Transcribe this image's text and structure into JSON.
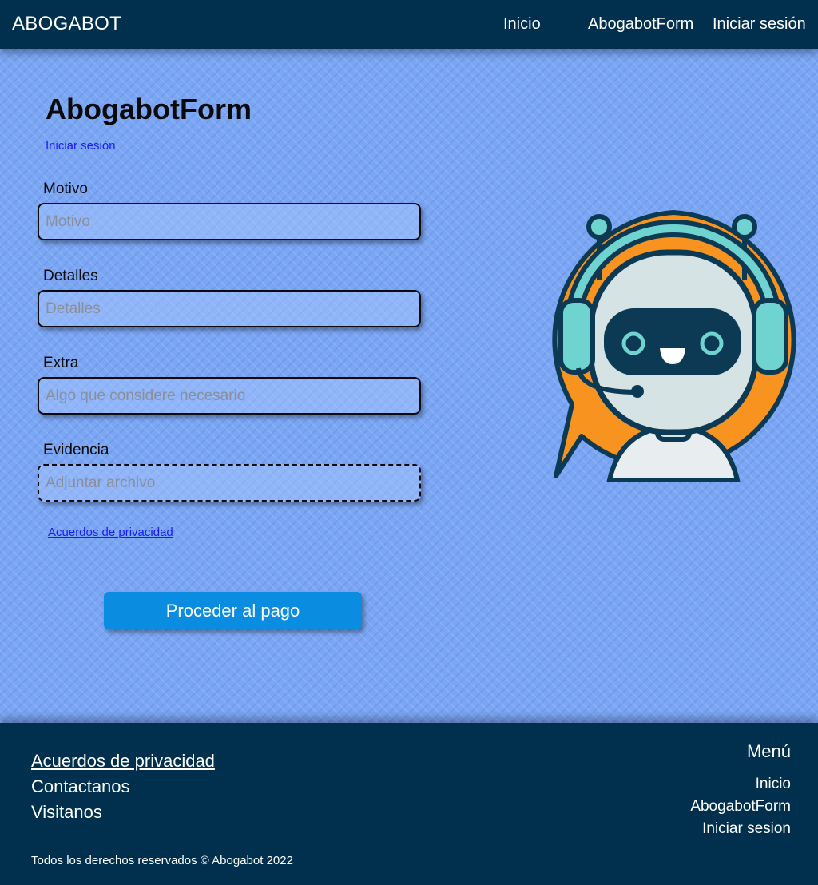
{
  "navbar": {
    "brand": "ABOGABOT",
    "links": [
      "Inicio",
      "AbogabotForm",
      "Iniciar sesión"
    ]
  },
  "form": {
    "title": "AbogabotForm",
    "login_link": "Iniciar sesión",
    "fields": [
      {
        "label": "Motivo",
        "placeholder": "Motivo"
      },
      {
        "label": "Detalles",
        "placeholder": "Detalles"
      },
      {
        "label": "Extra",
        "placeholder": "Algo que considere necesario"
      },
      {
        "label": "Evidencia",
        "placeholder": "Adjuntar archivo"
      }
    ],
    "privacy_link": "Acuerdos de privacidad",
    "submit_label": "Proceder al pago"
  },
  "illustration": {
    "icon": "chatbot-robot-icon",
    "colors": {
      "bubble": "#f7931e",
      "outline": "#0c3a55",
      "headphones": "#6fd3cf",
      "face": "#d5e3e5"
    }
  },
  "footer": {
    "links": [
      "Acuerdos de privacidad",
      "Contactanos",
      "Visitanos"
    ],
    "copyright": "Todos los derechos reservados © Abogabot 2022",
    "menu_heading": "Menú",
    "menu_links": [
      "Inicio",
      "AbogabotForm",
      "Iniciar sesion"
    ]
  },
  "colors": {
    "navbar_bg": "#00304e",
    "page_bg": "#7aa6f4",
    "button_bg": "#0a8ce0",
    "link": "#1a1aff"
  }
}
